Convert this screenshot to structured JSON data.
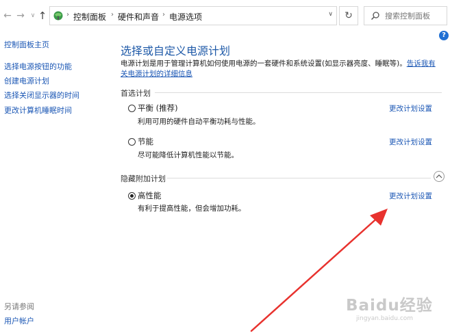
{
  "address_bar": {
    "crumbs": [
      "控制面板",
      "硬件和声音",
      "电源选项"
    ],
    "search_placeholder": "搜索控制面板"
  },
  "sidebar": {
    "items": [
      {
        "label": "控制面板主页"
      },
      {
        "label": "选择电源按钮的功能"
      },
      {
        "label": "创建电源计划"
      },
      {
        "label": "选择关闭显示器的时间"
      },
      {
        "label": "更改计算机睡眠时间"
      }
    ],
    "see_also_label": "另请参阅",
    "see_also_items": [
      {
        "label": "用户帐户"
      }
    ]
  },
  "main": {
    "title": "选择或自定义电源计划",
    "description": "电源计划是用于管理计算机如何使用电源的一套硬件和系统设置(如显示器亮度、睡眠等)。",
    "description_link": "告诉我有关电源计划的详细信息",
    "preferred_label": "首选计划",
    "hidden_label": "隐藏附加计划",
    "plans": [
      {
        "name": "平衡 (推荐)",
        "desc": "利用可用的硬件自动平衡功耗与性能。",
        "link": "更改计划设置",
        "selected": false
      },
      {
        "name": "节能",
        "desc": "尽可能降低计算机性能以节能。",
        "link": "更改计划设置",
        "selected": false
      },
      {
        "name": "高性能",
        "desc": "有利于提高性能，但会增加功耗。",
        "link": "更改计划设置",
        "selected": true
      }
    ]
  },
  "watermark": {
    "text": "Baidu经验",
    "sub": "jingyan.baidu.com"
  },
  "colors": {
    "accent": "#1a56b4",
    "arrow": "#e8322e"
  }
}
